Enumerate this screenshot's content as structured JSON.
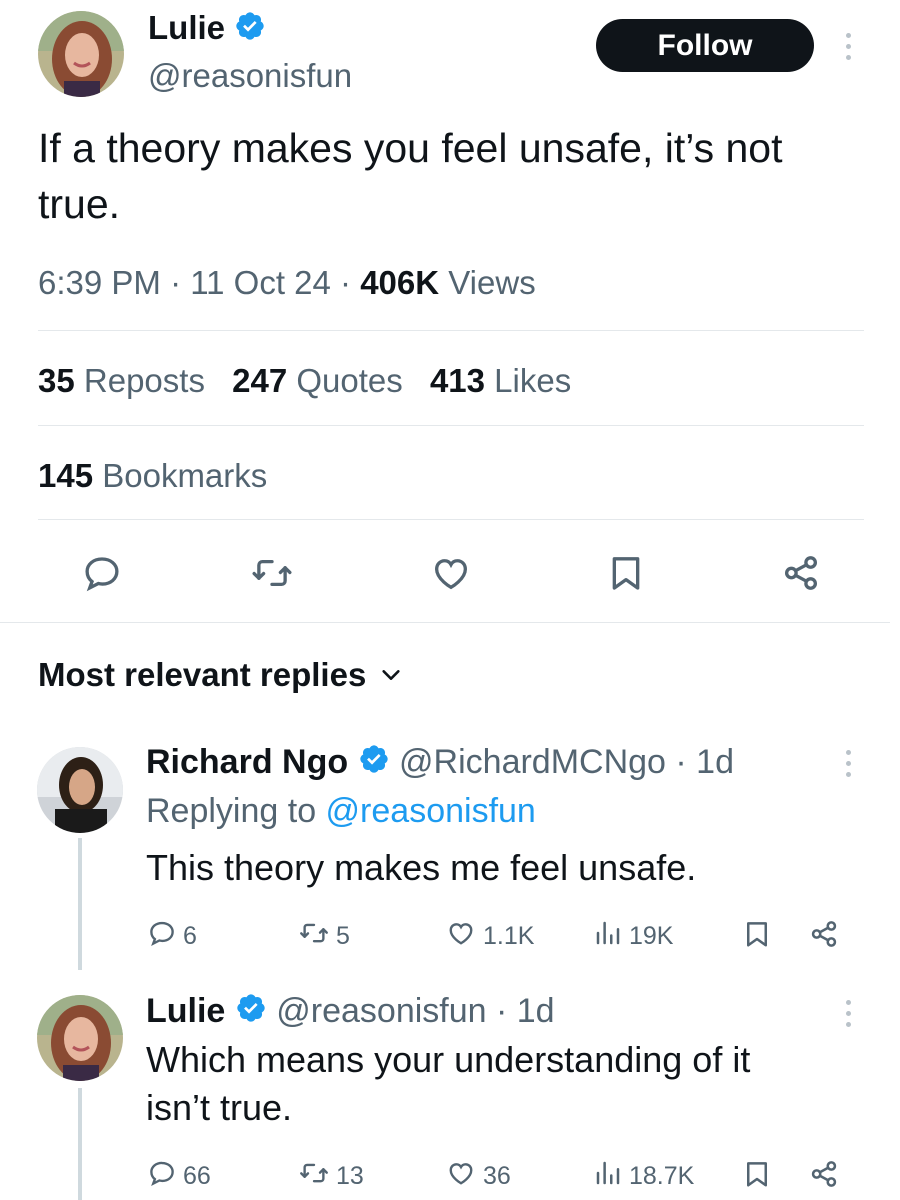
{
  "colors": {
    "accent": "#1d9bf0",
    "text": "#0f1419",
    "muted": "#536471",
    "divider": "#e4e8eb"
  },
  "tweet": {
    "author_name": "Lulie",
    "handle": "@reasonisfun",
    "follow_label": "Follow",
    "text": "If a theory makes you feel unsafe, it’s not true.",
    "time": "6:39 PM",
    "sep": " · ",
    "date": "11 Oct 24",
    "views_count": "406K",
    "views_label": " Views",
    "stats": {
      "reposts": {
        "count": "35",
        "label": " Reposts"
      },
      "quotes": {
        "count": "247",
        "label": " Quotes"
      },
      "likes": {
        "count": "413",
        "label": " Likes"
      },
      "bookmarks": {
        "count": "145",
        "label": " Bookmarks"
      }
    },
    "actions": [
      "reply-icon",
      "repost-icon",
      "like-icon",
      "bookmark-icon",
      "share-icon"
    ]
  },
  "replies_header": {
    "label": "Most relevant replies"
  },
  "replies": [
    {
      "author_name": "Richard Ngo",
      "handle": "@RichardMCNgo",
      "age": " · 1d",
      "replying_prefix": "Replying to ",
      "replying_handle": "@reasonisfun",
      "text": "This theory makes me feel unsafe.",
      "replies": "6",
      "reposts": "5",
      "likes": "1.1K",
      "views": "19K"
    },
    {
      "author_name": "Lulie",
      "handle": "@reasonisfun",
      "age": " · 1d",
      "text_line1": "Which means your understanding of it",
      "text_line2": "isn’t true.",
      "replies": "66",
      "reposts": "13",
      "likes": "36",
      "views": "18.7K"
    }
  ]
}
